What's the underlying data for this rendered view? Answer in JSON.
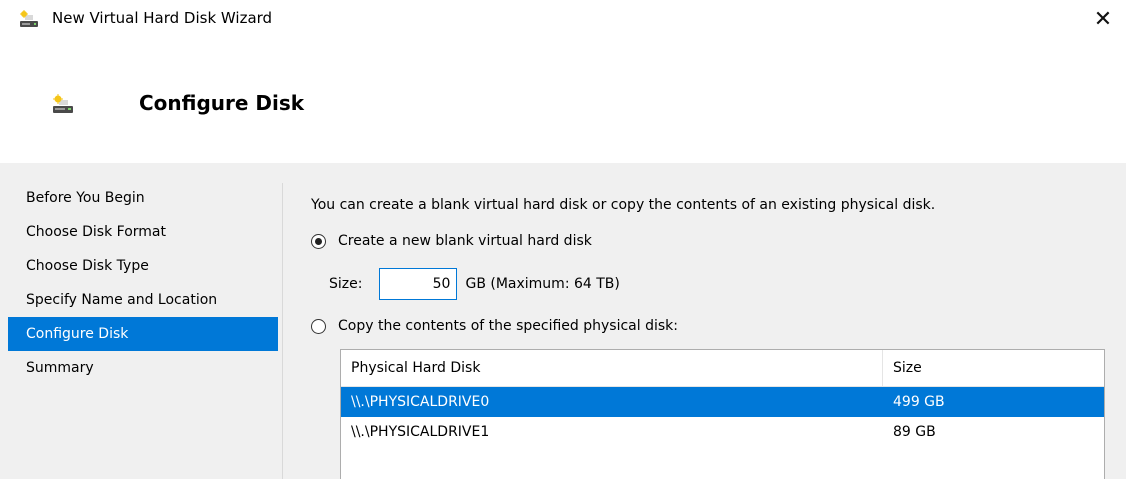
{
  "window": {
    "title": "New Virtual Hard Disk Wizard",
    "close_label": "✕"
  },
  "header": {
    "title": "Configure Disk"
  },
  "sidebar": {
    "items": [
      {
        "label": "Before You Begin",
        "active": false
      },
      {
        "label": "Choose Disk Format",
        "active": false
      },
      {
        "label": "Choose Disk Type",
        "active": false
      },
      {
        "label": "Specify Name and Location",
        "active": false
      },
      {
        "label": "Configure Disk",
        "active": true
      },
      {
        "label": "Summary",
        "active": false
      }
    ]
  },
  "main": {
    "intro": "You can create a blank virtual hard disk or copy the contents of an existing physical disk.",
    "option_new": {
      "label": "Create a new blank virtual hard disk",
      "checked": true
    },
    "size": {
      "label": "Size:",
      "value": "50",
      "unit": "GB (Maximum: 64 TB)"
    },
    "option_copy": {
      "label": "Copy the contents of the specified physical disk:",
      "checked": false
    },
    "table": {
      "columns": [
        "Physical Hard Disk",
        "Size"
      ],
      "rows": [
        {
          "disk": "\\\\.\\PHYSICALDRIVE0",
          "size": "499 GB",
          "selected": true
        },
        {
          "disk": "\\\\.\\PHYSICALDRIVE1",
          "size": "89 GB",
          "selected": false
        }
      ]
    }
  },
  "colors": {
    "accent": "#0078d7",
    "content_bg": "#f0f0f0"
  }
}
